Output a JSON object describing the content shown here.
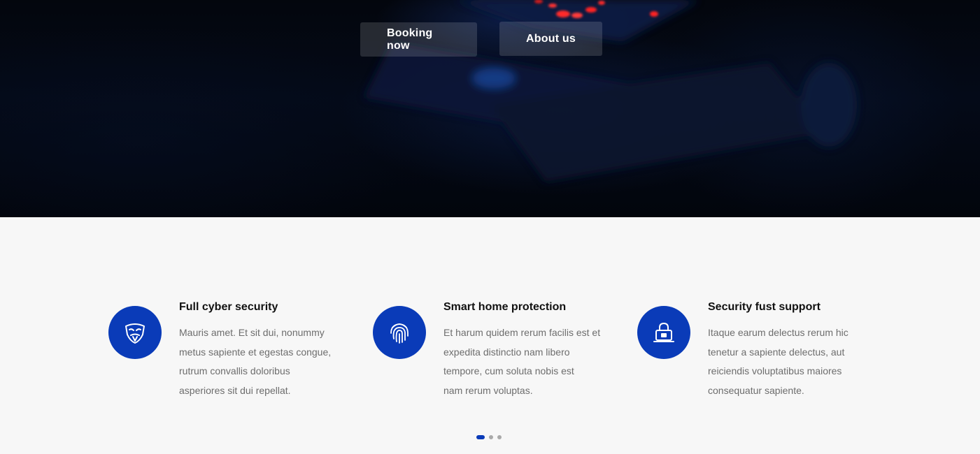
{
  "hero": {
    "buttons": {
      "booking_label": "Booking now",
      "about_label": "About us"
    }
  },
  "features": [
    {
      "icon": "mask-icon",
      "title": "Full cyber security",
      "text_lines": [
        "Mauris amet. Et sit dui, nonummy",
        "metus sapiente et egestas congue,",
        "rutrum convallis doloribus",
        "asperiores sit dui repellat."
      ]
    },
    {
      "icon": "fingerprint-icon",
      "title": "Smart home protection",
      "text_lines": [
        "Et harum quidem rerum facilis est et",
        "expedita distinctio nam libero",
        "tempore, cum soluta nobis est",
        "nam rerum voluptas."
      ]
    },
    {
      "icon": "lock-laptop-icon",
      "title": "Security fust support",
      "text_lines": [
        "Itaque earum delectus rerum hic",
        "tenetur a sapiente delectus, aut",
        "reiciendis voluptatibus maiores",
        "consequatur sapiente."
      ]
    }
  ],
  "pagination": {
    "count": 3,
    "active": 1
  },
  "colors": {
    "accent": "#0a3bb8",
    "hero_bg": "#03060d",
    "section_bg": "#f7f7f7"
  }
}
